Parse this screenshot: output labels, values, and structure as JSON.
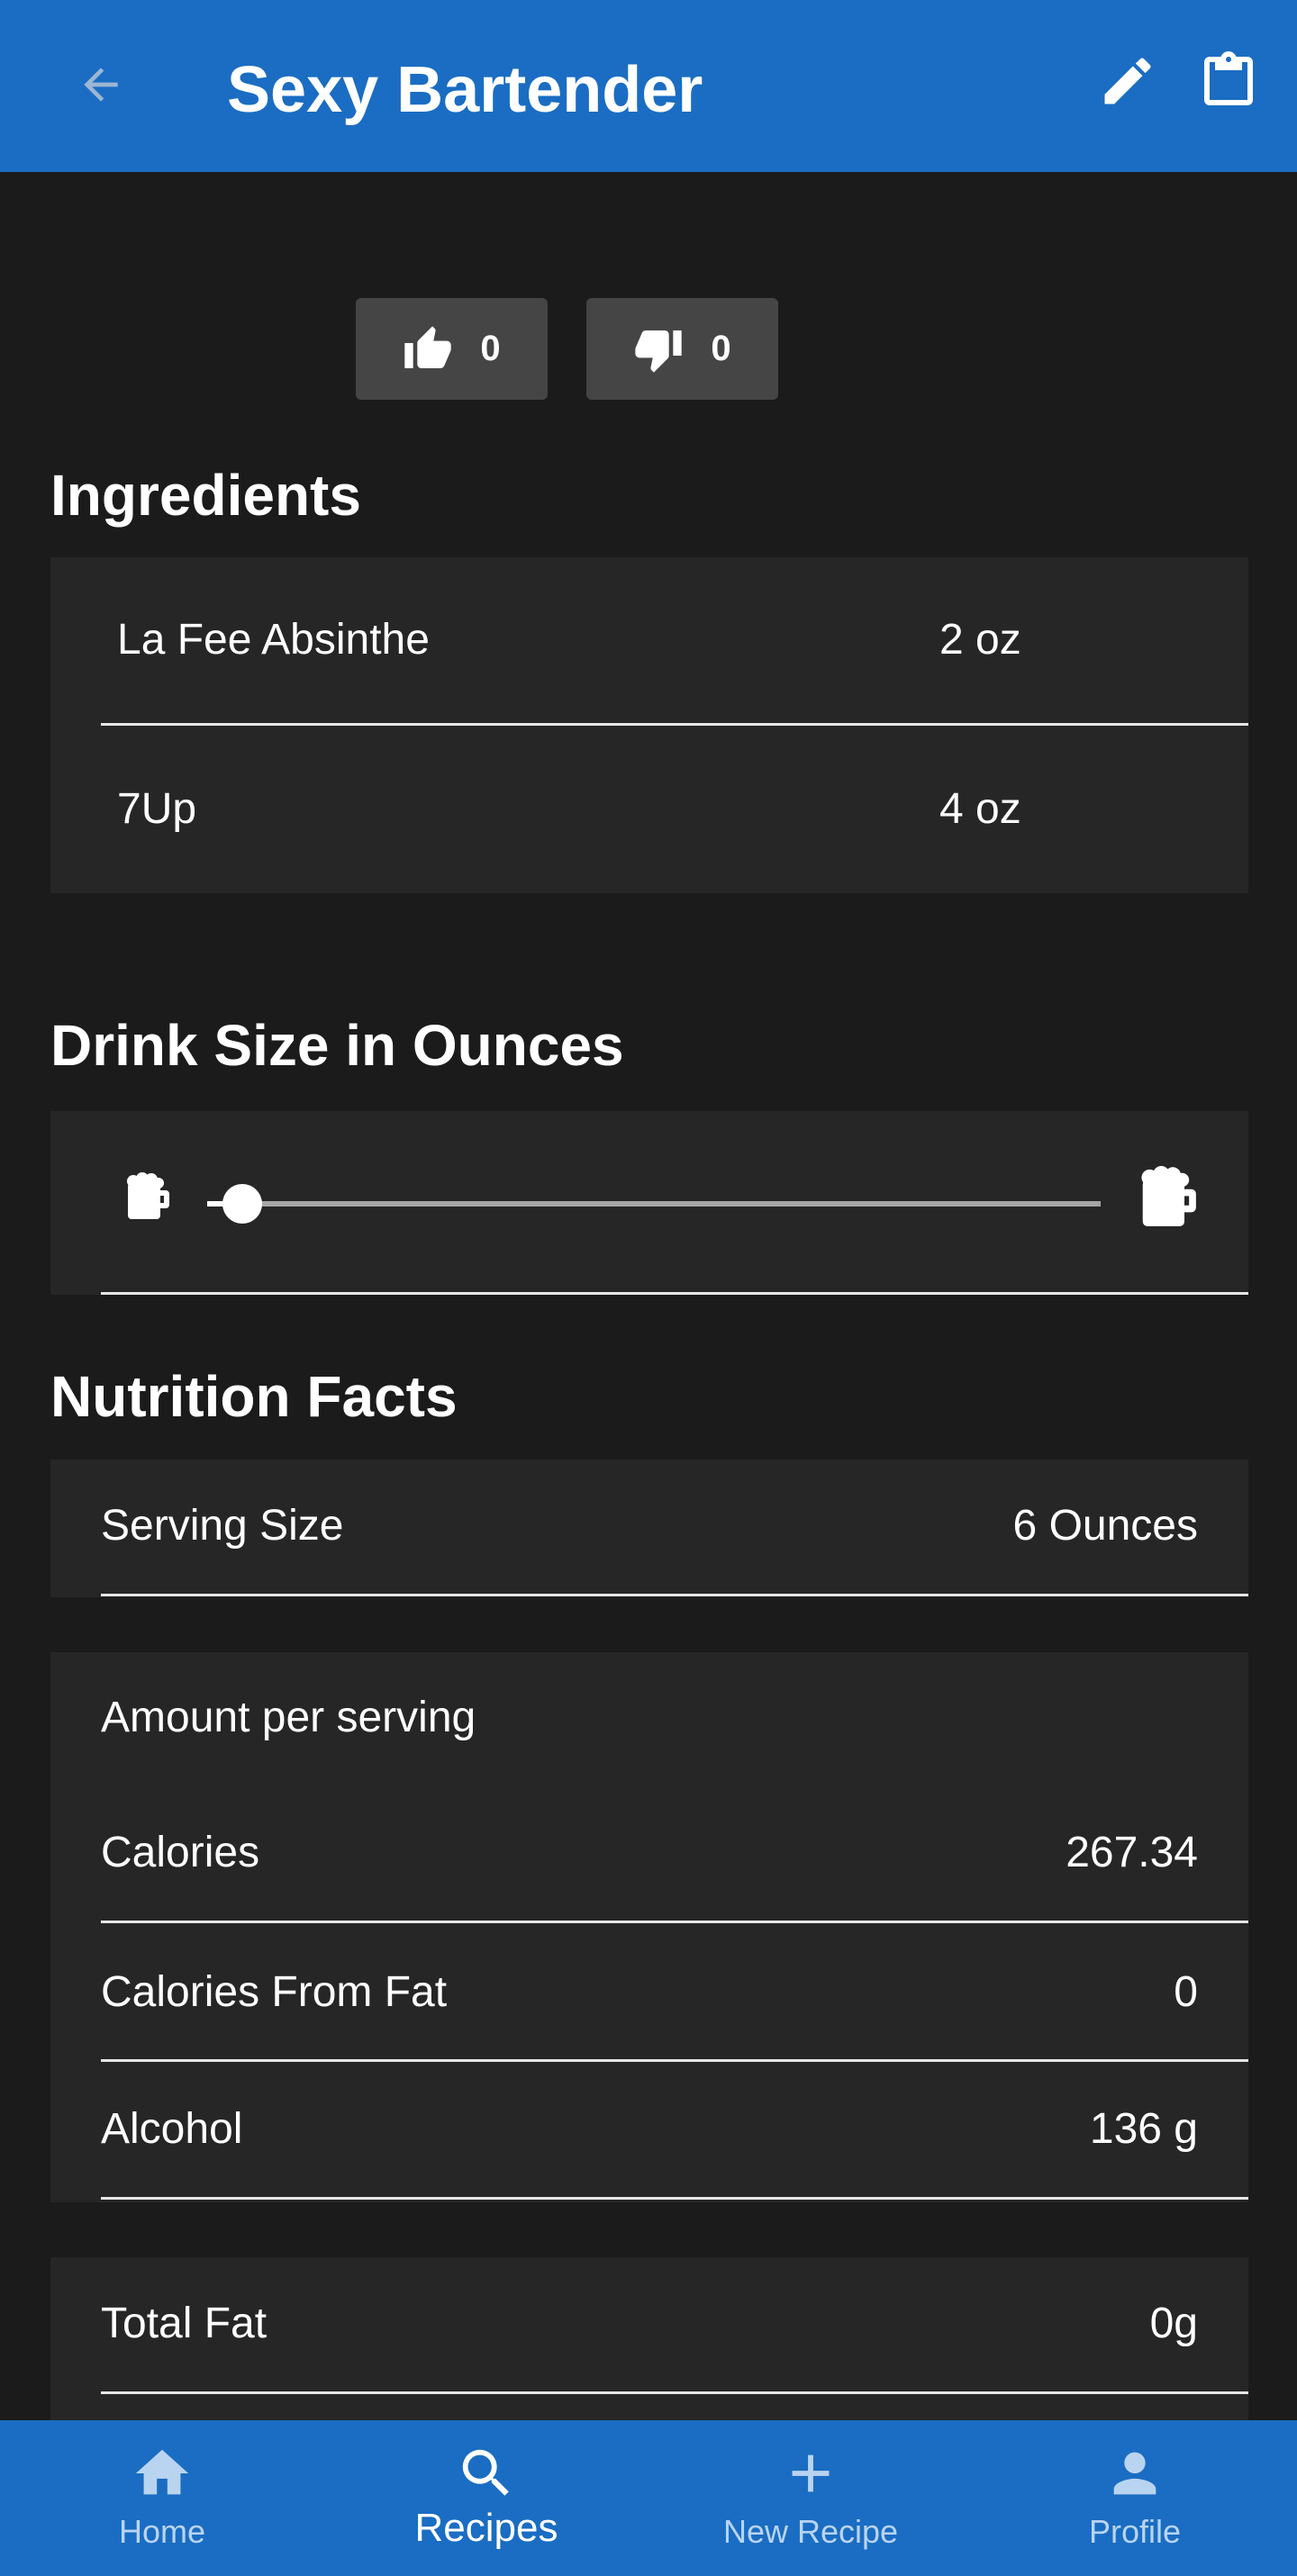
{
  "appbar": {
    "title": "Sexy Bartender",
    "back_icon": "arrow-left-icon",
    "edit_icon": "pencil-icon",
    "clipboard_icon": "clipboard-icon"
  },
  "votes": {
    "likes": "0",
    "dislikes": "0"
  },
  "ingredients": {
    "heading": "Ingredients",
    "items": [
      {
        "name": "La Fee Absinthe",
        "amount": "2 oz"
      },
      {
        "name": "7Up",
        "amount": "4 oz"
      }
    ]
  },
  "drink_size": {
    "heading": "Drink Size in Ounces",
    "slider_value_fraction": 0.03
  },
  "nutrition": {
    "heading": "Nutrition Facts",
    "serving_label": "Serving Size",
    "serving_value": "6 Ounces",
    "amount_per_serving": "Amount per serving",
    "calories_label": "Calories",
    "calories_value": "267.34",
    "calories_fat_label": "Calories From Fat",
    "calories_fat_value": "0",
    "alcohol_label": "Alcohol",
    "alcohol_value": "136 g",
    "total_fat_label": "Total Fat",
    "total_fat_value": "0g"
  },
  "bottom_nav": {
    "items": [
      {
        "label": "Home",
        "icon": "home-icon"
      },
      {
        "label": "Recipes",
        "icon": "search-icon",
        "active": true
      },
      {
        "label": "New Recipe",
        "icon": "plus-icon"
      },
      {
        "label": "Profile",
        "icon": "person-icon"
      }
    ]
  },
  "colors": {
    "primary": "#1a6dc2",
    "background": "#1b1b1b",
    "panel": "#262626",
    "vote_button": "#454545"
  }
}
